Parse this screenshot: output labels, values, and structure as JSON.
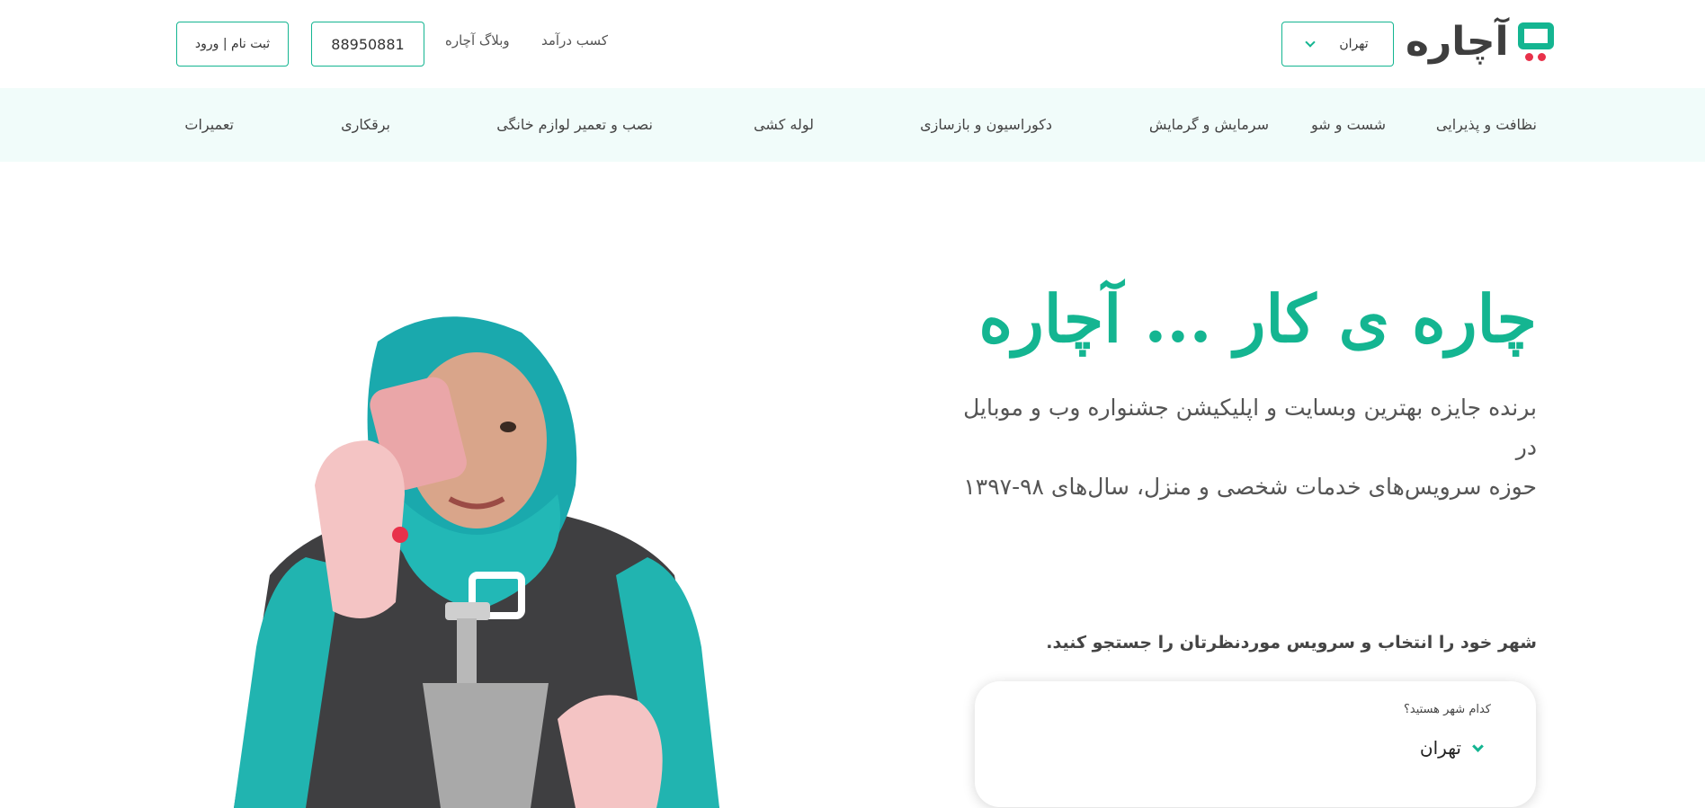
{
  "header": {
    "logo_text": "آچاره",
    "city": "تهران",
    "links": {
      "earn": "کسب درآمد",
      "blog": "وبلاگ آچاره"
    },
    "phone": "88950881",
    "login": "ثبت نام | ورود"
  },
  "categories": [
    "نظافت و پذیرایی",
    "شست و شو",
    "سرمایش و گرمایش",
    "دکوراسیون و بازسازی",
    "لوله کشی",
    "نصب و تعمیر لوازم خانگی",
    "برقکاری",
    "تعمیرات"
  ],
  "hero": {
    "title": "چاره ی کار ... آچاره",
    "subtitle_line1": "برنده جایزه بهترین وبسایت و اپلیکیشن جشنواره وب و موبایل در",
    "subtitle_line2": "حوزه سرویس‌های خدمات شخصی و منزل، سال‌های ۹۸-۱۳۹۷"
  },
  "search": {
    "label": "شهر خود را انتخاب و سرویس موردنظرتان را جستجو کنید.",
    "city_question": "کدام شهر هستید؟",
    "city_value": "تهران"
  },
  "colors": {
    "brand": "#14b591",
    "accent_red": "#e8314a",
    "nav_bg": "#f1fcfa"
  },
  "icons": [
    "achareh-logo-icon",
    "chevron-down-icon"
  ]
}
